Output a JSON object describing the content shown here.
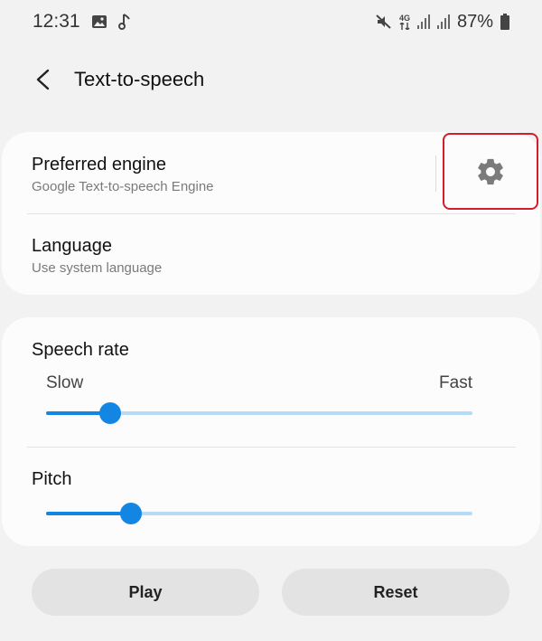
{
  "status_bar": {
    "time": "12:31",
    "network": "4G",
    "battery": "87%"
  },
  "header": {
    "title": "Text-to-speech"
  },
  "engine": {
    "title": "Preferred engine",
    "subtitle": "Google Text-to-speech Engine"
  },
  "language": {
    "title": "Language",
    "subtitle": "Use system language"
  },
  "speech_rate": {
    "label": "Speech rate",
    "min_label": "Slow",
    "max_label": "Fast",
    "value_fraction": 0.15
  },
  "pitch": {
    "label": "Pitch",
    "value_fraction": 0.2
  },
  "buttons": {
    "play": "Play",
    "reset": "Reset"
  },
  "colors": {
    "accent": "#1386e4",
    "track": "#b7daf5",
    "highlight": "#d21e2b"
  },
  "icons": {
    "back": "back-arrow-icon",
    "settings": "gear-icon"
  }
}
